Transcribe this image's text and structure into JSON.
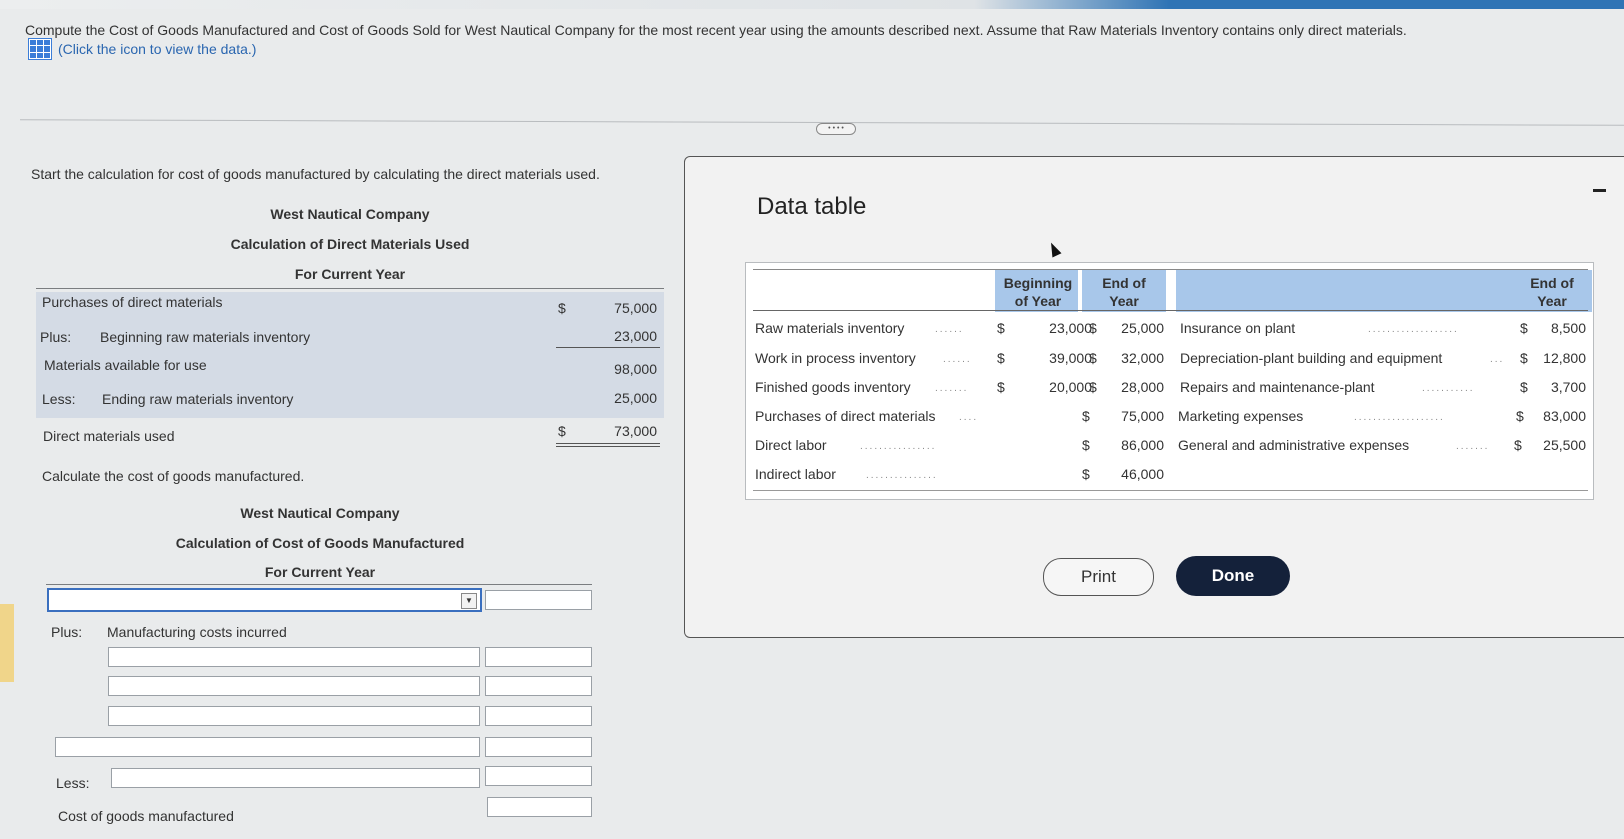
{
  "prompt": {
    "text": "Compute the Cost of Goods Manufactured and Cost of Goods Sold for West Nautical Company for the most recent year using the amounts described next. Assume that Raw Materials Inventory contains only direct materials.",
    "data_link": "(Click the icon to view the data.)"
  },
  "dm": {
    "intro": "Start the calculation for cost of goods manufactured by calculating the direct materials used.",
    "company": "West Nautical Company",
    "title": "Calculation of Direct Materials Used",
    "period": "For Current Year",
    "rows": [
      {
        "prefix": "",
        "label": "Purchases of direct materials",
        "dollar": "$",
        "amount": "75,000"
      },
      {
        "prefix": "Plus:",
        "label": "Beginning raw materials inventory",
        "dollar": "",
        "amount": "23,000"
      },
      {
        "prefix": "",
        "label": "Materials available for use",
        "dollar": "",
        "amount": "98,000"
      },
      {
        "prefix": "Less:",
        "label": "Ending raw materials inventory",
        "dollar": "",
        "amount": "25,000"
      },
      {
        "prefix": "",
        "label": "Direct materials used",
        "dollar": "$",
        "amount": "73,000"
      }
    ]
  },
  "cogm": {
    "intro": "Calculate the cost of goods manufactured.",
    "company": "West Nautical Company",
    "title": "Calculation of Cost of Goods Manufactured",
    "period": "For Current Year",
    "plus_label": "Plus:",
    "mfg_label": "Manufacturing costs incurred",
    "less_label": "Less:",
    "final_label": "Cost of goods manufactured"
  },
  "modal": {
    "title": "Data table",
    "col_begin": [
      "Beginning",
      "of Year"
    ],
    "col_end": [
      "End of",
      "Year"
    ],
    "col_end2": [
      "End of",
      "Year"
    ],
    "left_rows": [
      {
        "label": "Raw materials inventory",
        "d1": "$",
        "begin": "23,000",
        "d2": "$",
        "end": "25,000"
      },
      {
        "label": "Work in process inventory",
        "d1": "$",
        "begin": "39,000",
        "d2": "$",
        "end": "32,000"
      },
      {
        "label": "Finished goods inventory",
        "d1": "$",
        "begin": "20,000",
        "d2": "$",
        "end": "28,000"
      },
      {
        "label": "Purchases of direct materials",
        "d1": "",
        "begin": "",
        "d2": "$",
        "end": "75,000"
      },
      {
        "label": "Direct labor",
        "d1": "",
        "begin": "",
        "d2": "$",
        "end": "86,000"
      },
      {
        "label": "Indirect labor",
        "d1": "",
        "begin": "",
        "d2": "$",
        "end": "46,000"
      }
    ],
    "right_rows": [
      {
        "label": "Insurance on plant",
        "d": "$",
        "amount": "8,500"
      },
      {
        "label": "Depreciation-plant building and equipment",
        "d": "$",
        "amount": "12,800"
      },
      {
        "label": "Repairs and maintenance-plant",
        "d": "$",
        "amount": "3,700"
      },
      {
        "label": "Marketing expenses",
        "d": "$",
        "amount": "83,000"
      },
      {
        "label": "General and administrative expenses",
        "d": "$",
        "amount": "25,500"
      }
    ],
    "print_label": "Print",
    "done_label": "Done"
  }
}
